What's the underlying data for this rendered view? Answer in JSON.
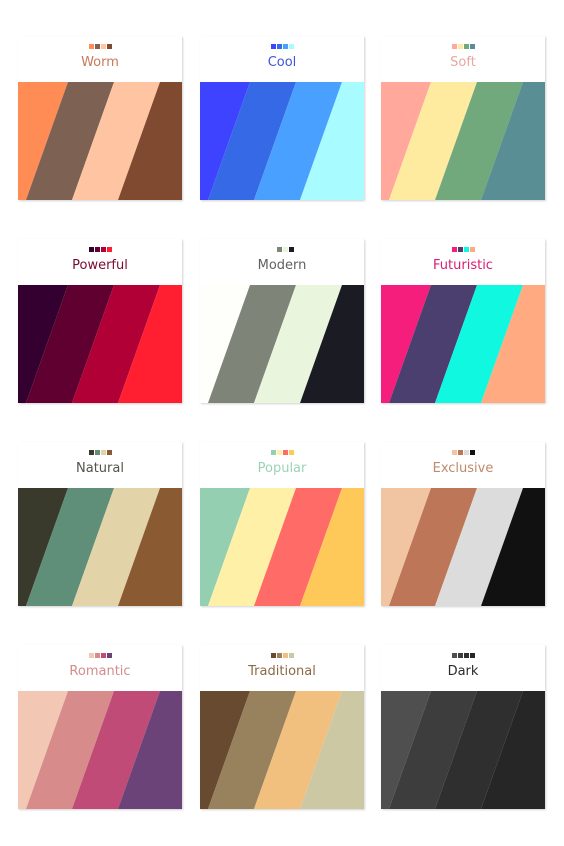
{
  "cards": [
    {
      "title": "Worm",
      "title_color": "#c9785a",
      "colors": [
        "#ff8c55",
        "#7d6253",
        "#ffc4a2",
        "#7f4a30"
      ]
    },
    {
      "title": "Cool",
      "title_color": "#3f55d8",
      "colors": [
        "#3d43ff",
        "#3569e6",
        "#4aa0ff",
        "#a8fbff"
      ]
    },
    {
      "title": "Soft",
      "title_color": "#e7a8a0",
      "colors": [
        "#ffa89b",
        "#ffeb9f",
        "#71a87c",
        "#588e94"
      ]
    },
    {
      "title": "Powerful",
      "title_color": "#7a0a34",
      "colors": [
        "#330030",
        "#600030",
        "#b10035",
        "#ff1f30"
      ]
    },
    {
      "title": "Modern",
      "title_color": "#606060",
      "colors": [
        "#fefefb",
        "#7f8479",
        "#eaf5de",
        "#1b1b24"
      ]
    },
    {
      "title": "Futuristic",
      "title_color": "#d81c76",
      "colors": [
        "#f51e7c",
        "#4a3f6f",
        "#10f8df",
        "#ffaa80"
      ]
    },
    {
      "title": "Natural",
      "title_color": "#51554a",
      "colors": [
        "#393a2c",
        "#5f8f78",
        "#e2d4a8",
        "#8a5a33"
      ]
    },
    {
      "title": "Popular",
      "title_color": "#9ad3b8",
      "colors": [
        "#94cfb2",
        "#fff0a8",
        "#ff6b66",
        "#ffc95a"
      ]
    },
    {
      "title": "Exclusive",
      "title_color": "#c08a6c",
      "colors": [
        "#f1c5a1",
        "#bd7657",
        "#dcdcdc",
        "#111111"
      ]
    },
    {
      "title": "Romantic",
      "title_color": "#d28d8c",
      "colors": [
        "#f2c8b4",
        "#d88b8b",
        "#bf4b76",
        "#6b4378"
      ]
    },
    {
      "title": "Traditional",
      "title_color": "#8b6a45",
      "colors": [
        "#674a30",
        "#98815d",
        "#f1bf7e",
        "#cdc8a4"
      ]
    },
    {
      "title": "Dark",
      "title_color": "#2b2b2b",
      "colors": [
        "#4f4f4f",
        "#3d3d3d",
        "#2f2f2f",
        "#262626"
      ]
    }
  ]
}
